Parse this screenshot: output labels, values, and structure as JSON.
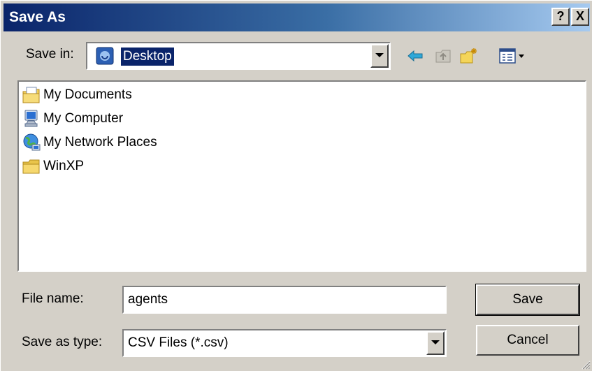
{
  "window": {
    "title": "Save As",
    "help_glyph": "?",
    "close_glyph": "X"
  },
  "save_in": {
    "label": "Save in:",
    "value": "Desktop",
    "icon": "desktop-icon"
  },
  "toolbar": {
    "icons": [
      "back-arrow-icon",
      "up-folder-icon",
      "new-folder-icon",
      "view-menu-icon"
    ]
  },
  "file_list": {
    "items": [
      {
        "label": "My Documents",
        "icon": "my-documents-icon"
      },
      {
        "label": "My Computer",
        "icon": "my-computer-icon"
      },
      {
        "label": "My Network Places",
        "icon": "network-places-icon"
      },
      {
        "label": "WinXP",
        "icon": "folder-icon"
      }
    ]
  },
  "file_name": {
    "label": "File name:",
    "value": "agents"
  },
  "save_as_type": {
    "label": "Save as type:",
    "value": "CSV Files (*.csv)"
  },
  "buttons": {
    "save": "Save",
    "cancel": "Cancel"
  },
  "colors": {
    "title_bar_start": "#0a246a",
    "title_bar_end": "#a6caf0",
    "dialog_face": "#d4d0c8",
    "selection": "#0a246a"
  }
}
